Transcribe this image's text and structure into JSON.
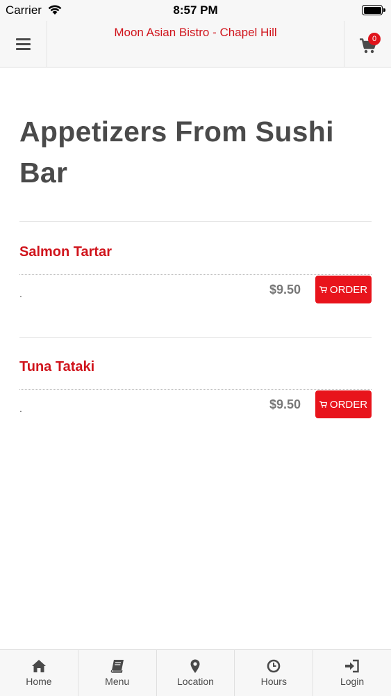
{
  "status_bar": {
    "carrier": "Carrier",
    "time": "8:57 PM"
  },
  "header": {
    "title": "Moon Asian Bistro - Chapel Hill",
    "cart_count": "0",
    "menu_icon": "hamburger-icon",
    "cart_icon": "cart-icon"
  },
  "page": {
    "title": "Appetizers From Sushi Bar"
  },
  "items": [
    {
      "name": "Salmon Tartar",
      "description": ".",
      "price": "$9.50",
      "order_label": "ORDER"
    },
    {
      "name": "Tuna Tataki",
      "description": ".",
      "price": "$9.50",
      "order_label": "ORDER"
    }
  ],
  "bottom_nav": [
    {
      "label": "Home",
      "icon": "home-icon"
    },
    {
      "label": "Menu",
      "icon": "book-icon"
    },
    {
      "label": "Location",
      "icon": "map-pin-icon"
    },
    {
      "label": "Hours",
      "icon": "clock-icon"
    },
    {
      "label": "Login",
      "icon": "login-icon"
    }
  ],
  "colors": {
    "accent": "#d0141c",
    "button": "#e8141c",
    "text": "#4a4a4a",
    "bar_background": "#f7f7f7"
  }
}
